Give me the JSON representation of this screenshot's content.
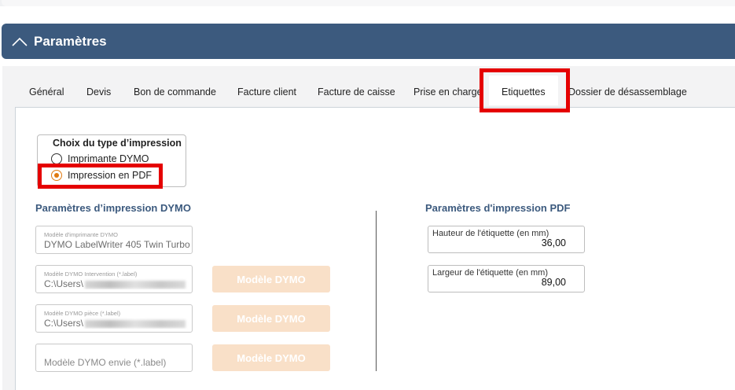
{
  "section": {
    "title": "Paramètres"
  },
  "tabs": [
    {
      "label": "Général"
    },
    {
      "label": "Devis"
    },
    {
      "label": "Bon de commande"
    },
    {
      "label": "Facture client"
    },
    {
      "label": "Facture de caisse"
    },
    {
      "label": "Prise en charge"
    },
    {
      "label": "Etiquettes",
      "active": true
    },
    {
      "label": "Dossier de désassemblage"
    }
  ],
  "print_choice": {
    "title": "Choix du type d’impression",
    "options": [
      {
        "label": "Imprimante DYMO",
        "checked": false
      },
      {
        "label": "Impression en PDF",
        "checked": true
      }
    ]
  },
  "dymo": {
    "title": "Paramètres d’impression DYMO",
    "printer_model": {
      "label": "Modèle d'imprimante DYMO",
      "value": "DYMO LabelWriter 405 Twin Turbo"
    },
    "intervention_model": {
      "label": "Modèle DYMO Intervention (*.label)",
      "value": "C:\\Users\\"
    },
    "part_model": {
      "label": "Modèle DYMO pièce (*.label)",
      "value": "C:\\Users\\"
    },
    "envie_model": {
      "placeholder": "Modèle DYMO envie (*.label)"
    },
    "button_label": "Modèle DYMO"
  },
  "pdf": {
    "title": "Paramètres d'impression PDF",
    "height": {
      "label": "Hauteur de l'étiquette (en mm)",
      "value": "36,00"
    },
    "width": {
      "label": "Largeur de l'étiquette (en mm)",
      "value": "89,00"
    }
  },
  "colors": {
    "header": "#3c5a7e",
    "accent": "#e07a10",
    "highlight": "#e50000",
    "disabled_button": "#f9e0c8"
  }
}
